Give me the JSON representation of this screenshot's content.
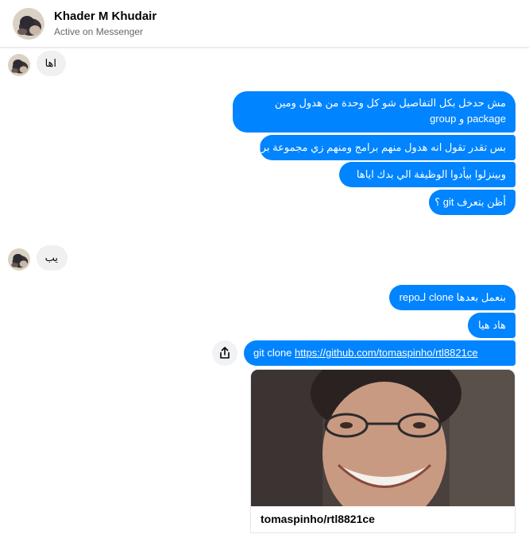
{
  "header": {
    "name": "Khader M Khudair",
    "status": "Active on Messenger"
  },
  "messages": {
    "in1": "اها",
    "out1": "مش حدخل بكل التفاصيل شو كل وحدة من هدول ومين package و group",
    "out2": "بس تقدر تقول انه هدول منهم برامج ومنهم زي مجموعة برامج",
    "out3": "وبينزلوا بيأدوا الوظيفة الي بدك اياها",
    "out4": "أظن بتعرف git ؟",
    "in2": "يب",
    "out5": "بنعمل بعدها clone لـrepo",
    "out6": "هاد هيا",
    "out7_prefix": "git clone ",
    "out7_link": "https://github.com/tomaspinho/rtl8821ce"
  },
  "link_card": {
    "title": "tomaspinho/rtl8821ce"
  },
  "icons": {
    "share": "share-icon",
    "avatar": "contact-avatar"
  },
  "colors": {
    "outgoing_bubble": "#0084ff",
    "incoming_bubble": "#f0f0f0",
    "secondary_text": "#65676b"
  }
}
